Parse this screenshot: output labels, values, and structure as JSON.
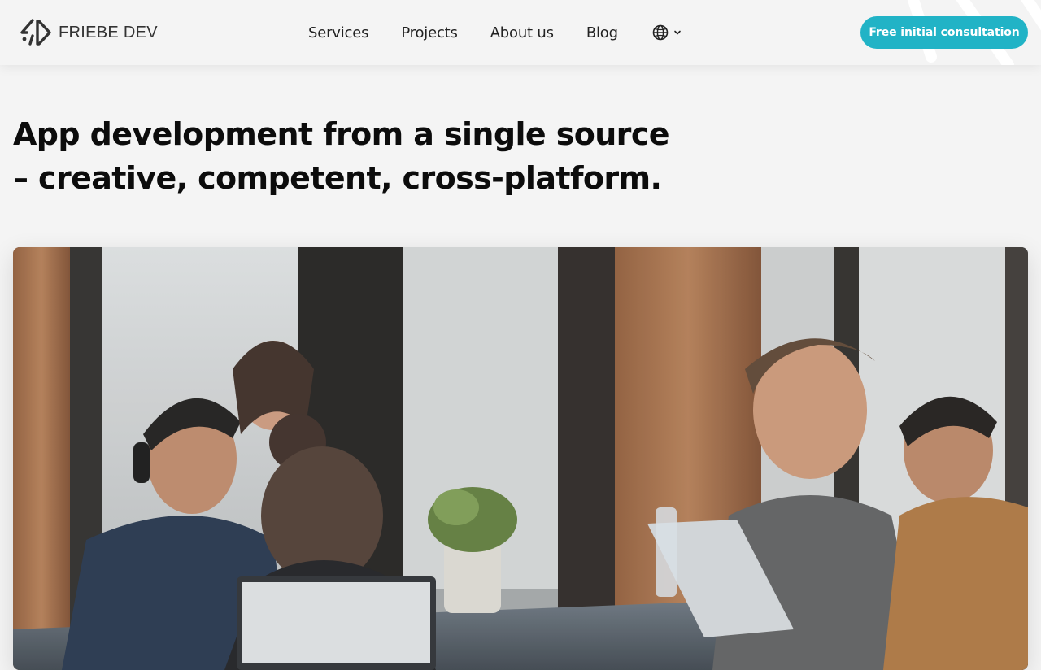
{
  "header": {
    "logo_text": "FRIEBE DEV",
    "nav": [
      {
        "label": "Services"
      },
      {
        "label": "Projects"
      },
      {
        "label": "About us"
      },
      {
        "label": "Blog"
      }
    ],
    "language_icon": "globe-icon",
    "language_dropdown_icon": "chevron-down-icon",
    "cta_label": "Free initial consultation"
  },
  "hero": {
    "title_line1": "App development from a single source",
    "title_line2": "– creative, competent, cross-platform.",
    "image_alt": "Team of developers working together on laptops at a table"
  },
  "colors": {
    "accent": "#21b3c6",
    "background": "#f4f4f4",
    "text": "#111111"
  }
}
